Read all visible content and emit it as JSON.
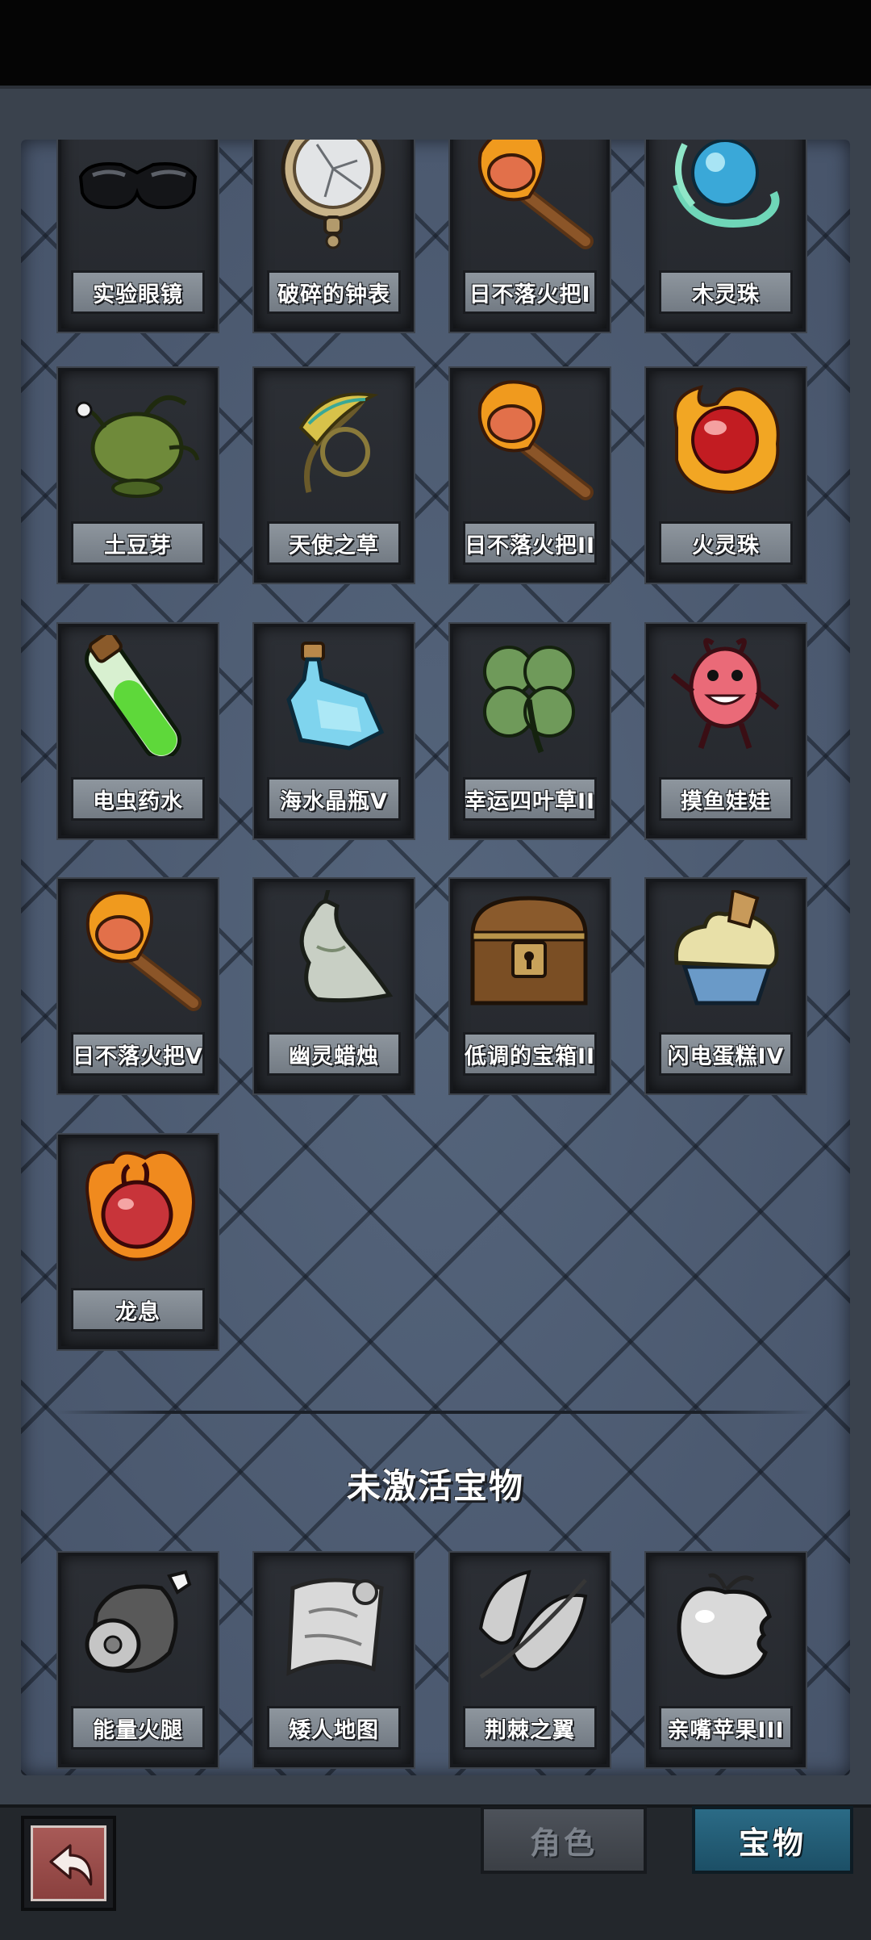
{
  "active_items": [
    {
      "name": "实验眼镜",
      "icon": "lab-goggles-icon"
    },
    {
      "name": "破碎的钟表",
      "icon": "broken-pocket-watch-icon"
    },
    {
      "name": "日不落火把I",
      "icon": "torch-icon"
    },
    {
      "name": "木灵珠",
      "icon": "wood-spirit-orb-icon"
    },
    {
      "name": "土豆芽",
      "icon": "potato-sprout-icon"
    },
    {
      "name": "天使之草",
      "icon": "angel-grass-icon"
    },
    {
      "name": "日不落火把II",
      "icon": "torch-icon"
    },
    {
      "name": "火灵珠",
      "icon": "fire-spirit-orb-icon"
    },
    {
      "name": "电虫药水",
      "icon": "green-potion-vial-icon"
    },
    {
      "name": "海水晶瓶V",
      "icon": "sea-crystal-bottle-icon"
    },
    {
      "name": "幸运四叶草II",
      "icon": "four-leaf-clover-icon"
    },
    {
      "name": "摸鱼娃娃",
      "icon": "pink-doll-icon"
    },
    {
      "name": "日不落火把V",
      "icon": "torch-icon"
    },
    {
      "name": "幽灵蜡烛",
      "icon": "ghost-candle-icon"
    },
    {
      "name": "低调的宝箱II",
      "icon": "treasure-chest-icon"
    },
    {
      "name": "闪电蛋糕IV",
      "icon": "lightning-cake-icon"
    },
    {
      "name": "龙息",
      "icon": "dragon-breath-heart-icon"
    }
  ],
  "inactive_section_title": "未激活宝物",
  "inactive_items": [
    {
      "name": "能量火腿",
      "icon": "energy-ham-icon"
    },
    {
      "name": "矮人地图",
      "icon": "dwarf-map-icon"
    },
    {
      "name": "荆棘之翼",
      "icon": "thorn-wings-icon"
    },
    {
      "name": "亲嘴苹果III",
      "icon": "bitten-apple-icon"
    }
  ],
  "tabs": {
    "role": "角色",
    "treasure": "宝物",
    "selected": "treasure"
  },
  "back_icon": "back-arrow-icon",
  "colors": {
    "panel": "#4f5d72",
    "card": "#2a2d32",
    "label": "#7f878f",
    "selected_tab": "#24607a",
    "back_button": "#9b4d4a"
  }
}
